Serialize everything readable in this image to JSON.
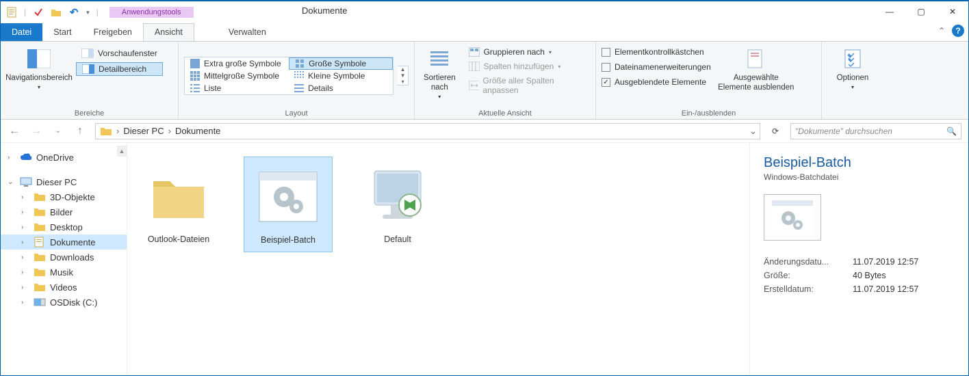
{
  "window": {
    "title": "Dokumente",
    "context_tab": "Anwendungstools"
  },
  "tabs": {
    "file": "Datei",
    "start": "Start",
    "share": "Freigeben",
    "view": "Ansicht",
    "manage": "Verwalten"
  },
  "ribbon": {
    "panes": {
      "nav": "Navigationsbereich",
      "preview": "Vorschaufenster",
      "detail": "Detailbereich",
      "group_label": "Bereiche"
    },
    "layout": {
      "xl": "Extra große Symbole",
      "l": "Große Symbole",
      "m": "Mittelgroße Symbole",
      "s": "Kleine Symbole",
      "list": "Liste",
      "details": "Details",
      "group_label": "Layout"
    },
    "current_view": {
      "sort": "Sortieren nach",
      "group": "Gruppieren nach",
      "add_cols": "Spalten hinzufügen",
      "fit_cols": "Größe aller Spalten anpassen",
      "group_label": "Aktuelle Ansicht"
    },
    "show_hide": {
      "item_check": "Elementkontrollkästchen",
      "file_ext": "Dateinamenerweiterungen",
      "hidden": "Ausgeblendete Elemente",
      "hide_sel": "Ausgewählte Elemente ausblenden",
      "group_label": "Ein-/ausblenden"
    },
    "options": "Optionen"
  },
  "breadcrumb": {
    "pc": "Dieser PC",
    "loc": "Dokumente"
  },
  "search": {
    "placeholder": "\"Dokumente\" durchsuchen"
  },
  "tree": {
    "onedrive": "OneDrive",
    "this_pc": "Dieser PC",
    "items": [
      "3D-Objekte",
      "Bilder",
      "Desktop",
      "Dokumente",
      "Downloads",
      "Musik",
      "Videos",
      "OSDisk (C:)"
    ]
  },
  "files": [
    {
      "name": "Outlook-Dateien",
      "type": "folder"
    },
    {
      "name": "Beispiel-Batch",
      "type": "batch",
      "selected": true
    },
    {
      "name": "Default",
      "type": "rdp"
    }
  ],
  "details": {
    "title": "Beispiel-Batch",
    "subtitle": "Windows-Batchdatei",
    "rows": [
      {
        "k": "Änderungsdatu...",
        "v": "11.07.2019 12:57"
      },
      {
        "k": "Größe:",
        "v": "40 Bytes"
      },
      {
        "k": "Erstelldatum:",
        "v": "11.07.2019 12:57"
      }
    ]
  }
}
